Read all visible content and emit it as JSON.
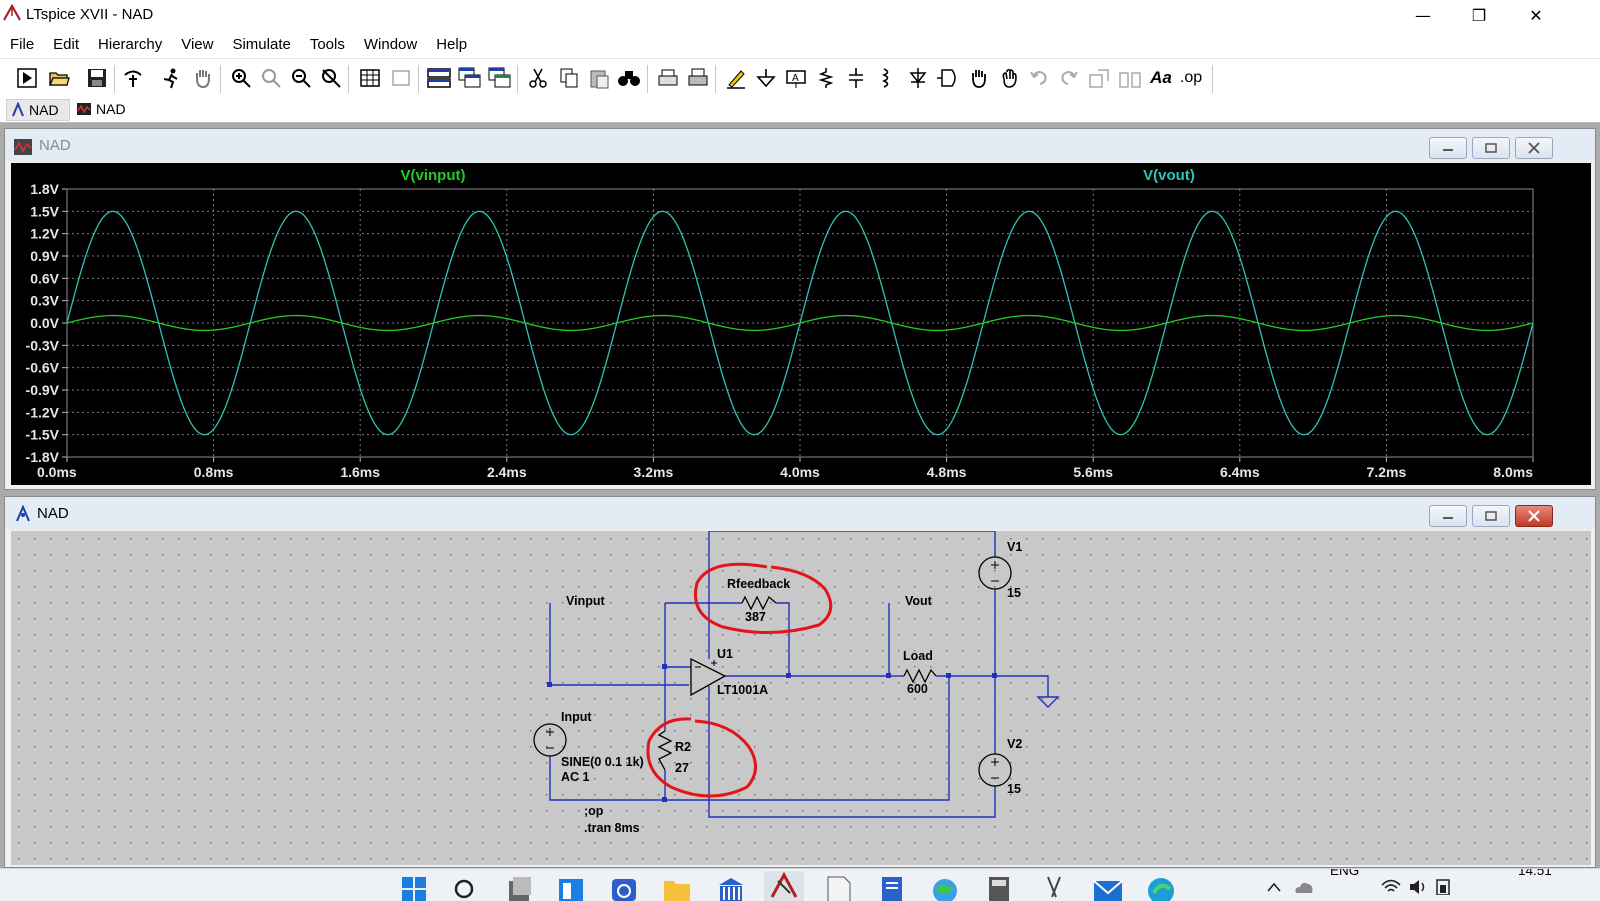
{
  "window": {
    "title": "LTspice XVII - NAD",
    "controls": {
      "minimize": "—",
      "restore": "❐",
      "close": "✕"
    }
  },
  "menu": [
    "File",
    "Edit",
    "Hierarchy",
    "View",
    "Simulate",
    "Tools",
    "Window",
    "Help"
  ],
  "toolbar_icons": [
    "run-icon",
    "open-icon",
    "save-icon",
    "control-panel-icon",
    "run-sim-icon",
    "pan-icon",
    "zoom-in-icon",
    "zoom-full-icon",
    "zoom-out-icon",
    "zoom-cancel-icon",
    "autorange-icon",
    "grid-icon",
    "tile-horizontal-icon",
    "cascade-icon",
    "tile-vertical-icon",
    "cut-icon",
    "copy-icon",
    "paste-icon",
    "find-icon",
    "print-icon",
    "print-setup-icon",
    "pencil-icon",
    "ground-icon",
    "label-icon",
    "resistor-icon",
    "capacitor-icon",
    "inductor-icon",
    "diode-icon",
    "component-icon",
    "move-icon",
    "drag-icon",
    "undo-icon",
    "redo-icon",
    "rotate-icon",
    "mirror-icon",
    "text-icon",
    "spice-directive-icon"
  ],
  "toolbar_text": {
    "text": "Aa",
    "spice": ".op"
  },
  "doc_tabs": [
    {
      "label": "NAD",
      "icon": "schematic-icon",
      "active": true
    },
    {
      "label": "NAD",
      "icon": "waveform-icon",
      "active": false
    }
  ],
  "plot_window": {
    "title": "NAD",
    "chart_data": {
      "type": "line",
      "series": [
        {
          "name": "V(vinput)",
          "color": "#22cc22",
          "amplitude": 0.1,
          "frequency_hz": 1000,
          "unit": "V"
        },
        {
          "name": "V(vout)",
          "color": "#2ec4b6",
          "amplitude": 1.5,
          "frequency_hz": 1000,
          "unit": "V"
        }
      ],
      "x_ticks": [
        "0.0ms",
        "0.8ms",
        "1.6ms",
        "2.4ms",
        "3.2ms",
        "4.0ms",
        "4.8ms",
        "5.6ms",
        "6.4ms",
        "7.2ms",
        "8.0ms"
      ],
      "y_ticks": [
        "1.8V",
        "1.5V",
        "1.2V",
        "0.9V",
        "0.6V",
        "0.3V",
        "0.0V",
        "-0.3V",
        "-0.6V",
        "-0.9V",
        "-1.2V",
        "-1.5V",
        "-1.8V"
      ],
      "xlim_ms": [
        0,
        8
      ],
      "ylim": [
        -1.8,
        1.8
      ],
      "grid": true,
      "background": "#000000"
    }
  },
  "schematic_window": {
    "title": "NAD",
    "labels": {
      "vinput": "Vinput",
      "vout": "Vout",
      "rfeedback": "Rfeedback",
      "rfeedback_val": "387",
      "u1": "U1",
      "u1_model": "LT1001A",
      "load": "Load",
      "load_val": "600",
      "v1": "V1",
      "v1_val": "15",
      "v2": "V2",
      "v2_val": "15",
      "input": "Input",
      "input_val1": "SINE(0 0.1 1k)",
      "input_val2": "AC 1",
      "r2": "R2",
      "r2_val": "27",
      "op": ";op",
      "tran": ".tran 8ms"
    }
  },
  "taskbar": {
    "icons": [
      "start-icon",
      "search-icon",
      "task-view-icon",
      "widgets-icon",
      "chat-icon",
      "file-explorer-icon",
      "bank-icon",
      "ltspice-icon",
      "notepad-icon",
      "notes-icon",
      "browser-icon",
      "calculator-icon",
      "scissors-icon",
      "mail-icon",
      "edge-icon"
    ],
    "language": "ENG",
    "clock": "14:51"
  }
}
